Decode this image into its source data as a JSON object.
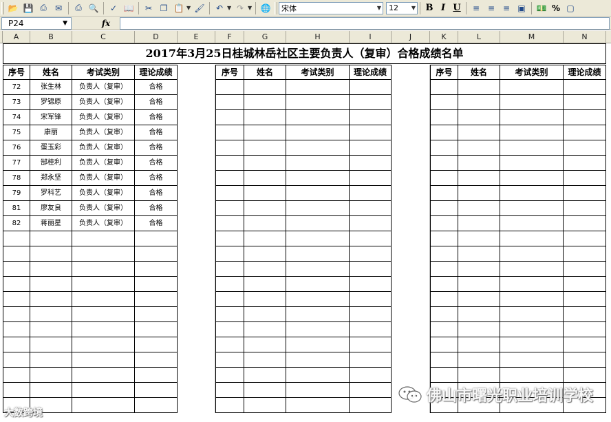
{
  "toolbar": {
    "font_name": "宋体",
    "font_size": "12",
    "bold": "B",
    "italic": "I",
    "underline": "U",
    "percent": "%"
  },
  "formula_bar": {
    "name_box": "P24",
    "fx": "fx"
  },
  "columns": [
    "A",
    "B",
    "C",
    "D",
    "E",
    "F",
    "G",
    "H",
    "I",
    "J",
    "K",
    "L",
    "M",
    "N"
  ],
  "sheet": {
    "title": "2017年3月25日桂城林岳社区主要负责人（复审）合格成绩名单",
    "headers": [
      "序号",
      "姓名",
      "考试类别",
      "理论成绩"
    ],
    "rows": [
      {
        "no": "72",
        "name": "张生林",
        "category": "负责人（复审）",
        "score": "合格"
      },
      {
        "no": "73",
        "name": "罗锦原",
        "category": "负责人（复审）",
        "score": "合格"
      },
      {
        "no": "74",
        "name": "宋军锋",
        "category": "负责人（复审）",
        "score": "合格"
      },
      {
        "no": "75",
        "name": "康丽",
        "category": "负责人（复审）",
        "score": "合格"
      },
      {
        "no": "76",
        "name": "蛋玉彩",
        "category": "负责人（复审）",
        "score": "合格"
      },
      {
        "no": "77",
        "name": "郜桂利",
        "category": "负责人（复审）",
        "score": "合格"
      },
      {
        "no": "78",
        "name": "郑永坚",
        "category": "负责人（复审）",
        "score": "合格"
      },
      {
        "no": "79",
        "name": "罗科艺",
        "category": "负责人（复审）",
        "score": "合格"
      },
      {
        "no": "81",
        "name": "廖友良",
        "category": "负责人（复审）",
        "score": "合格"
      },
      {
        "no": "82",
        "name": "蒋丽星",
        "category": "负责人（复审）",
        "score": "合格"
      }
    ]
  },
  "watermarks": {
    "right": "佛山市曙光职业培训学校",
    "left": "大数跨境"
  }
}
